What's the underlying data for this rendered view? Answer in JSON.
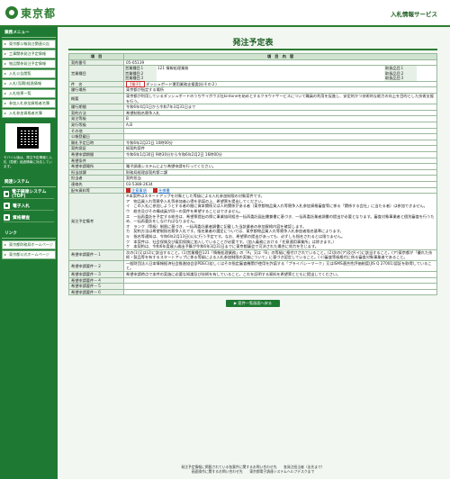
{
  "header": {
    "logo_text": "東京都",
    "site_title": "入札情報サービス"
  },
  "sidebar": {
    "heading": "業務メニュー",
    "items": [
      "東京都公報発注関連公告",
      "工事関係発注予定情報",
      "物品関係発注予定情報",
      "入札公告閲覧",
      "入札(見積)経過情報",
      "入札結果一覧",
      "参加入札参加資格者名簿",
      "入札参加資格者名簿"
    ],
    "mobile_text": "モバイル版は、発注予定情報と入札（見積）経過情報に対応しています。",
    "links_heading": "関連システム",
    "links": [
      "電子調達システム(TOP)",
      "電子入札",
      "資格審査"
    ],
    "bottom_heading": "リンク",
    "bottom_links": [
      "東京都財務局ホームページ",
      "東京都公式ホームページ"
    ]
  },
  "page": {
    "title": "発注予定表",
    "col_item": "項　目",
    "col_content": "項　目　内　容"
  },
  "rows": [
    {
      "label": "契約番号",
      "value": "05-05139"
    },
    {
      "label": "営業種目",
      "sub": [
        {
          "name": "営業種目１",
          "value": "121 情報処理業務",
          "grp_label": "取扱品目１",
          "grp_value": ""
        },
        {
          "name": "営業種目２",
          "value": "",
          "grp_label": "取扱品目２",
          "grp_value": ""
        },
        {
          "name": "営業種目３",
          "value": "",
          "grp_label": "取扱品目３",
          "grp_value": ""
        }
      ]
    },
    {
      "label": "件　名",
      "tag": "【電子】",
      "value": "ダッシュボード運用業務支援委託(その２)"
    },
    {
      "label": "履行場所",
      "value": "東京都が指定する場所"
    },
    {
      "label": "概要",
      "value": "東京都が利用しているダッシュボードのうちサイボウズ社kintoneを始めとするクラウドサービスについて職員の利用を促進し、安定的かつ技術的な能力の向上を目的とした技術支援を行う。"
    },
    {
      "label": "履行期間",
      "value": "令和6年4月1日から令和7年3月31日まで"
    },
    {
      "label": "契約方法",
      "value": "希望制指名競争入札"
    },
    {
      "label": "発注等級",
      "value": "B"
    },
    {
      "label": "発行等級",
      "value": "A,B"
    },
    {
      "label": "その他",
      "value": ""
    },
    {
      "label": "公報登載日",
      "value": ""
    },
    {
      "label": "開札予定日時",
      "value": "令和6年2月21日 10時00分"
    },
    {
      "label": "契約保証",
      "value": "紙契約案件"
    },
    {
      "label": "希望申請期間",
      "value": "令和6年1月30日 9時30分から令和6年2月2日 16時00分"
    },
    {
      "label": "希望条件",
      "value": ""
    },
    {
      "label": "希望申請場所",
      "value": "電子調達システムにより希望申請を行ってください。"
    },
    {
      "label": "担当部課",
      "value": "財務局経理部契約第二課"
    },
    {
      "label": "担当者",
      "value": "契約担当"
    },
    {
      "label": "連絡先",
      "value": "03-5388-2634"
    },
    {
      "label": "配布資料等",
      "pdf1": "注意事項",
      "pdf2": "仕様書"
    },
    {
      "label": "発注予定備考",
      "notes": [
        "※本案件はスタートアップを対象とした等級による入札参加制限の対象案件です。",
        "ア　物品買入れ等競争入札等参加者心得を承諾の上、希望票を提出してください。",
        "イ　この入札に参加しようとする者の間に資本関係又は人的関係がある者（東京都物品買入れ等競争入札参加資格審査等に係る「関係する会社」に当たる者）は参加できません。",
        "ウ　総合及びその構成員が同一の案件を希望することはできません。",
        "エ　一括再委託を予定する総合は、希望票提出の際に事業協同組合一括再委託届出書兼書に基づき、一括再委託業者調書の提出が必要となります。審査対象事業者と個別審査を行うため、一括再委託をしなければなりません。",
        "オ　ランク（等級）制限に基づき、一括再委託業者調書に記載した当該業者の参加資格内容を確認します。",
        "カ　契約方法は希望制指名競争入札です。指名業者の選定については、東京都物品買入れ等競争入札参加者指名基準によります。",
        "キ　指名等通知は、令和6年2月13日(火)に行う予定です。なお、希望票の提出があっても、必ずしも指名されるとは限りません。",
        "ク　本案件は、社会保険及び雇用保険に加入していることが必要です。（加入義務における「任意適用事業所」は除きます。）",
        "ケ　本契約は、令和6年度歳入歳出予算が令和6年3月31日までに東京都議会で可決された場合に効力を生じます。"
      ]
    },
    {
      "label": "希望申請要件－１",
      "value": "次の(1)又は(2)に該当すること。(1)営業種目121「情報処理業務」の「A」又は「B」の等級に格付けされていること。(2)次の(ア)及び(イ)に該当すること。(ア)東京都が「優れた技術・製品等を有するスタートアップに係る等級による入札参加制限の実施について」に基づき認定していること。(イ)審査等級格付に係る審査対象事業者であること。"
    },
    {
      "label": "希望申請要件－２",
      "value": "一般財団法人日本情報経済社会推進協会(JIPDEC)若しくはその指定審査機関が使用を許諾する「プライバシーマーク」又はISMS適合性評価制度(JIS Q 27001)認証を取得していること。"
    },
    {
      "label": "希望申請要件－３",
      "value": "希望申請時点で本件の実施に必要な知識及び技術を有していること。これを証明する資料を希望票とともに提出してください。"
    },
    {
      "label": "希望申請要件－４",
      "value": ""
    },
    {
      "label": "希望申請要件－５",
      "value": ""
    },
    {
      "label": "希望申請要件－６",
      "value": ""
    }
  ],
  "back_button": "▶ 案件一覧画面へ戻る",
  "footer": {
    "line1": "発注予定情報に掲載されている各案件に関するお問い合わせ先　　各発注担当者（出先まで）",
    "line2": "画面操作に関するお問い合わせ先　　東京都電子調達システムヘルプデスクまで"
  }
}
